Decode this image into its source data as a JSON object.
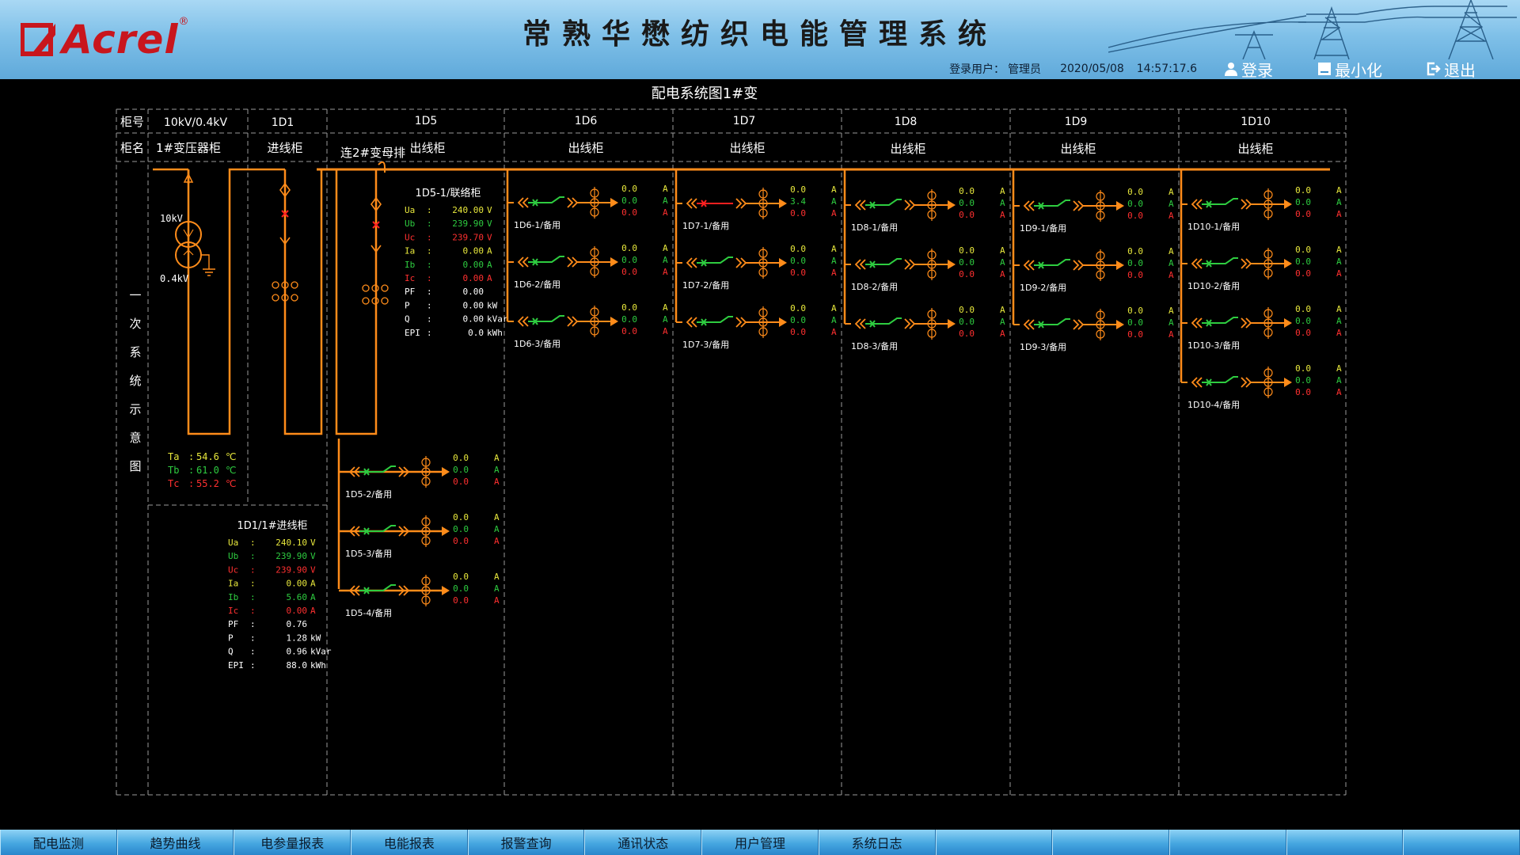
{
  "header": {
    "logo_text": "Acrel",
    "logo_reg": "®",
    "title": "常熟华懋纺织电能管理系统",
    "user_label": "登录用户：",
    "user_name": "管理员",
    "date": "2020/05/08",
    "time": "14:57:17.6",
    "login_label": "登录",
    "minimize_label": "最小化",
    "logout_label": "退出"
  },
  "diagram": {
    "title": "配电系统图1#变",
    "row_label_no": "柜号",
    "row_label_name": "柜名",
    "side_label": [
      "一",
      "次",
      "系",
      "统",
      "示",
      "意",
      "图"
    ],
    "columns": [
      {
        "no": "10kV/0.4kV",
        "name": "1#变压器柜"
      },
      {
        "no": "1D1",
        "name": "进线柜"
      },
      {
        "no": "1D5",
        "name": "出线柜"
      },
      {
        "no": "1D6",
        "name": "出线柜"
      },
      {
        "no": "1D7",
        "name": "出线柜"
      },
      {
        "no": "1D8",
        "name": "出线柜"
      },
      {
        "no": "1D9",
        "name": "出线柜"
      },
      {
        "no": "1D10",
        "name": "出线柜"
      }
    ],
    "bus_tie_label": "连2#变母排",
    "transformer": {
      "hv": "10kV",
      "lv": "0.4kV",
      "temps": [
        {
          "label": "Ta",
          "value": "54.6",
          "unit": "℃",
          "color": "#e8e83c"
        },
        {
          "label": "Tb",
          "value": "61.0",
          "unit": "℃",
          "color": "#2ecc40"
        },
        {
          "label": "Tc",
          "value": "55.2",
          "unit": "℃",
          "color": "#ff3030"
        }
      ]
    },
    "incoming": {
      "title": "1D1/1#进线柜",
      "rows": [
        {
          "label": "Ua",
          "value": "240.10",
          "unit": "V",
          "color": "#e8e83c"
        },
        {
          "label": "Ub",
          "value": "239.90",
          "unit": "V",
          "color": "#2ecc40"
        },
        {
          "label": "Uc",
          "value": "239.90",
          "unit": "V",
          "color": "#ff3030"
        },
        {
          "label": "Ia",
          "value": "0.00",
          "unit": "A",
          "color": "#e8e83c"
        },
        {
          "label": "Ib",
          "value": "5.60",
          "unit": "A",
          "color": "#2ecc40"
        },
        {
          "label": "Ic",
          "value": "0.00",
          "unit": "A",
          "color": "#ff3030"
        },
        {
          "label": "PF",
          "value": "0.76",
          "unit": "",
          "color": "#ffffff"
        },
        {
          "label": "P",
          "value": "1.28",
          "unit": "kW",
          "color": "#ffffff"
        },
        {
          "label": "Q",
          "value": "0.96",
          "unit": "kVar",
          "color": "#ffffff"
        },
        {
          "label": "EPI",
          "value": "88.0",
          "unit": "kWh",
          "color": "#ffffff"
        }
      ]
    },
    "tie": {
      "title": "1D5-1/联络柜",
      "rows": [
        {
          "label": "Ua",
          "value": "240.00",
          "unit": "V",
          "color": "#e8e83c"
        },
        {
          "label": "Ub",
          "value": "239.90",
          "unit": "V",
          "color": "#2ecc40"
        },
        {
          "label": "Uc",
          "value": "239.70",
          "unit": "V",
          "color": "#ff3030"
        },
        {
          "label": "Ia",
          "value": "0.00",
          "unit": "A",
          "color": "#e8e83c"
        },
        {
          "label": "Ib",
          "value": "0.00",
          "unit": "A",
          "color": "#2ecc40"
        },
        {
          "label": "Ic",
          "value": "0.00",
          "unit": "A",
          "color": "#ff3030"
        },
        {
          "label": "PF",
          "value": "0.00",
          "unit": "",
          "color": "#ffffff"
        },
        {
          "label": "P",
          "value": "0.00",
          "unit": "kW",
          "color": "#ffffff"
        },
        {
          "label": "Q",
          "value": "0.00",
          "unit": "kVar",
          "color": "#ffffff"
        },
        {
          "label": "EPI",
          "value": "0.0",
          "unit": "kWh",
          "color": "#ffffff"
        }
      ]
    },
    "feeder_groups": [
      {
        "col": 2,
        "feeders": [
          {
            "name": "1D5-2/备用",
            "state": "closed",
            "a": "0.0",
            "b": "0.0",
            "c": "0.0"
          },
          {
            "name": "1D5-3/备用",
            "state": "closed",
            "a": "0.0",
            "b": "0.0",
            "c": "0.0"
          },
          {
            "name": "1D5-4/备用",
            "state": "closed",
            "a": "0.0",
            "b": "0.0",
            "c": "0.0"
          }
        ]
      },
      {
        "col": 3,
        "feeders": [
          {
            "name": "1D6-1/备用",
            "state": "closed",
            "a": "0.0",
            "b": "0.0",
            "c": "0.0"
          },
          {
            "name": "1D6-2/备用",
            "state": "closed",
            "a": "0.0",
            "b": "0.0",
            "c": "0.0"
          },
          {
            "name": "1D6-3/备用",
            "state": "closed",
            "a": "0.0",
            "b": "0.0",
            "c": "0.0"
          }
        ]
      },
      {
        "col": 4,
        "feeders": [
          {
            "name": "1D7-1/备用",
            "state": "fault",
            "a": "0.0",
            "b": "3.4",
            "c": "0.0"
          },
          {
            "name": "1D7-2/备用",
            "state": "closed",
            "a": "0.0",
            "b": "0.0",
            "c": "0.0"
          },
          {
            "name": "1D7-3/备用",
            "state": "closed",
            "a": "0.0",
            "b": "0.0",
            "c": "0.0"
          }
        ]
      },
      {
        "col": 5,
        "feeders": [
          {
            "name": "1D8-1/备用",
            "state": "closed",
            "a": "0.0",
            "b": "0.0",
            "c": "0.0"
          },
          {
            "name": "1D8-2/备用",
            "state": "closed",
            "a": "0.0",
            "b": "0.0",
            "c": "0.0"
          },
          {
            "name": "1D8-3/备用",
            "state": "closed",
            "a": "0.0",
            "b": "0.0",
            "c": "0.0"
          }
        ]
      },
      {
        "col": 6,
        "feeders": [
          {
            "name": "1D9-1/备用",
            "state": "closed",
            "a": "0.0",
            "b": "0.0",
            "c": "0.0"
          },
          {
            "name": "1D9-2/备用",
            "state": "closed",
            "a": "0.0",
            "b": "0.0",
            "c": "0.0"
          },
          {
            "name": "1D9-3/备用",
            "state": "closed",
            "a": "0.0",
            "b": "0.0",
            "c": "0.0"
          }
        ]
      },
      {
        "col": 7,
        "feeders": [
          {
            "name": "1D10-1/备用",
            "state": "closed",
            "a": "0.0",
            "b": "0.0",
            "c": "0.0"
          },
          {
            "name": "1D10-2/备用",
            "state": "closed",
            "a": "0.0",
            "b": "0.0",
            "c": "0.0"
          },
          {
            "name": "1D10-3/备用",
            "state": "closed",
            "a": "0.0",
            "b": "0.0",
            "c": "0.0"
          },
          {
            "name": "1D10-4/备用",
            "state": "closed",
            "a": "0.0",
            "b": "0.0",
            "c": "0.0"
          }
        ]
      }
    ],
    "unit_a": "A",
    "colors": {
      "bus": "#ff8c1a",
      "closed": "#2ecc40",
      "fault": "#ff2020",
      "phase_a": "#e8e83c",
      "phase_b": "#2ecc40",
      "phase_c": "#ff3030",
      "grid": "#9a9a9a"
    }
  },
  "nav": {
    "tabs": [
      "配电监测",
      "趋势曲线",
      "电参量报表",
      "电能报表",
      "报警查询",
      "通讯状态",
      "用户管理",
      "系统日志",
      "",
      "",
      "",
      "",
      ""
    ]
  }
}
